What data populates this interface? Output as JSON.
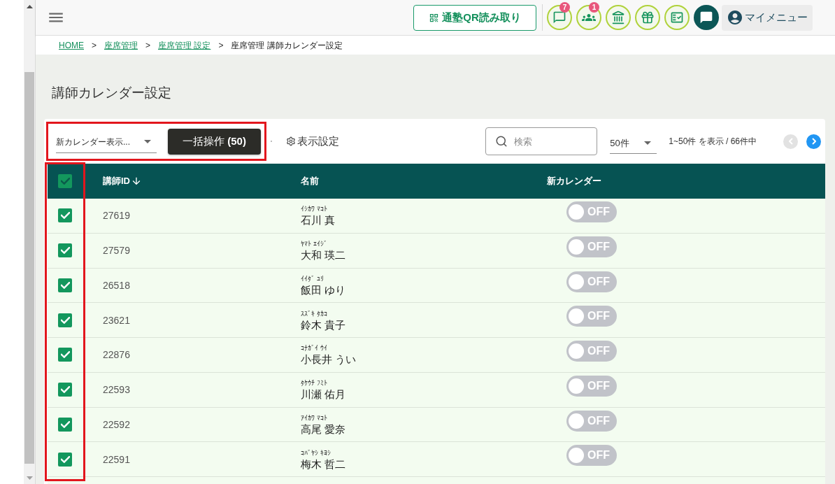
{
  "header": {
    "qr_button": {
      "label": "通塾QR読み取り"
    },
    "icon_buttons": [
      {
        "kind": "chat",
        "badge": "7"
      },
      {
        "kind": "group",
        "badge": "1"
      },
      {
        "kind": "school"
      },
      {
        "kind": "gift"
      },
      {
        "kind": "checklist"
      },
      {
        "kind": "message"
      }
    ],
    "my_menu": {
      "label": "マイメニュー"
    }
  },
  "breadcrumb": [
    {
      "kind": "link",
      "label": "HOME"
    },
    {
      "kind": "separator",
      "label": ">"
    },
    {
      "kind": "link",
      "label": "座席管理"
    },
    {
      "kind": "separator",
      "label": ">"
    },
    {
      "kind": "link",
      "label": "座席管理 設定"
    },
    {
      "kind": "separator",
      "label": ">"
    },
    {
      "kind": "current",
      "label": "座席管理 講師カレンダー設定"
    }
  ],
  "page_title": "講師カレンダー設定",
  "toolbar": {
    "filter_select": {
      "value": "新カレンダー表示..."
    },
    "bulk_button": {
      "label": "一括操作 **(50)**"
    },
    "display_settings": {
      "label": "表示設定"
    },
    "search": {
      "placeholder": "検索"
    },
    "per_page": {
      "value": "50件"
    },
    "range_text": "1~50件 を表示 / 66件中",
    "prev_page": {
      "disabled": true
    },
    "next_page": {
      "disabled": false
    }
  },
  "table": {
    "select_all": {
      "checked": true
    },
    "columns": [
      {
        "label": "講師ID",
        "sort_descending": true
      },
      {
        "label": "名前"
      },
      {
        "label": "新カレンダー"
      }
    ],
    "rows": [
      {
        "checked": true,
        "teacher_id": "27619",
        "reading": "ｲｼｶﾜ ﾏｺﾄ",
        "name": "石川 真",
        "new_calendar": {
          "on": false,
          "label": "OFF"
        }
      },
      {
        "checked": true,
        "teacher_id": "27579",
        "reading": "ﾔﾏﾄ ｴｲｼﾞ",
        "name": "大和 瑛二",
        "new_calendar": {
          "on": false,
          "label": "OFF"
        }
      },
      {
        "checked": true,
        "teacher_id": "26518",
        "reading": "ｲｲﾀﾞ ﾕﾘ",
        "name": "飯田 ゆり",
        "new_calendar": {
          "on": false,
          "label": "OFF"
        }
      },
      {
        "checked": true,
        "teacher_id": "23621",
        "reading": "ｽｽﾞｷ ﾀｶｺ",
        "name": "鈴木 貴子",
        "new_calendar": {
          "on": false,
          "label": "OFF"
        }
      },
      {
        "checked": true,
        "teacher_id": "22876",
        "reading": "ｺﾅｶﾞｲ ｳｲ",
        "name": "小長井 うい",
        "new_calendar": {
          "on": false,
          "label": "OFF"
        }
      },
      {
        "checked": true,
        "teacher_id": "22593",
        "reading": "ﾀｹｳﾁ ﾌﾐﾄ",
        "name": "川瀬 佑月",
        "new_calendar": {
          "on": false,
          "label": "OFF"
        }
      },
      {
        "checked": true,
        "teacher_id": "22592",
        "reading": "ｱｲｶﾜ ﾏｺﾄ",
        "name": "高尾 愛奈",
        "new_calendar": {
          "on": false,
          "label": "OFF"
        }
      },
      {
        "checked": true,
        "teacher_id": "22591",
        "reading": "ｺﾊﾞﾔｼ ｷﾖｼ",
        "name": "梅木 哲二",
        "new_calendar": {
          "on": false,
          "label": "OFF"
        }
      }
    ]
  }
}
